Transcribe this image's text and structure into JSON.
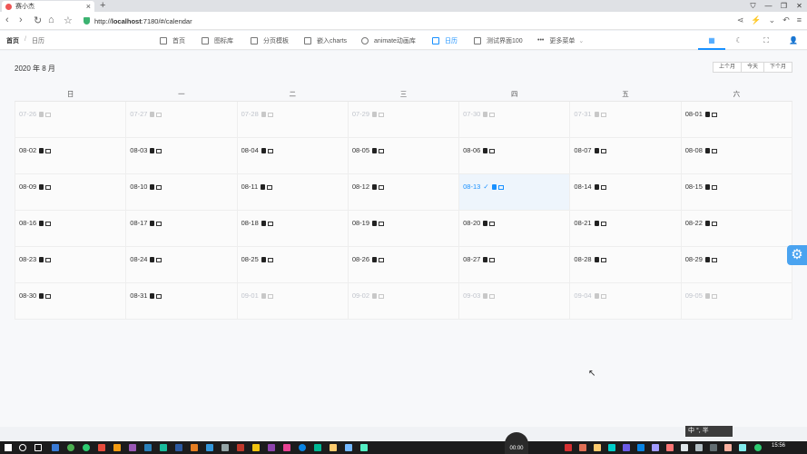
{
  "browser": {
    "tab_title": "赛小杰",
    "url_prefix": "http://",
    "url_host": "localhost",
    "url_rest": ":7180/#/calendar"
  },
  "breadcrumb": {
    "home": "首页",
    "current": "日历"
  },
  "nav": [
    {
      "label": "首页",
      "icon": "home-icon"
    },
    {
      "label": "图标库",
      "icon": "star-icon"
    },
    {
      "label": "分页模板",
      "icon": "table-icon"
    },
    {
      "label": "嵌入charts",
      "icon": "chart-icon"
    },
    {
      "label": "animate动画库",
      "icon": "search-icon"
    },
    {
      "label": "日历",
      "icon": "calendar-icon",
      "active": true
    },
    {
      "label": "测试界面100",
      "icon": "document-icon"
    },
    {
      "label": "更多菜单",
      "icon": "more-icon"
    }
  ],
  "calendar": {
    "title": "2020 年 8 月",
    "prev_label": "上个月",
    "today_label": "今天",
    "next_label": "下个月",
    "weekdays": [
      "日",
      "一",
      "二",
      "三",
      "四",
      "五",
      "六"
    ],
    "weeks": [
      [
        "07-26",
        "07-27",
        "07-28",
        "07-29",
        "07-30",
        "07-31",
        "08-01"
      ],
      [
        "08-02",
        "08-03",
        "08-04",
        "08-05",
        "08-06",
        "08-07",
        "08-08"
      ],
      [
        "08-09",
        "08-10",
        "08-11",
        "08-12",
        "08-13",
        "08-14",
        "08-15"
      ],
      [
        "08-16",
        "08-17",
        "08-18",
        "08-19",
        "08-20",
        "08-21",
        "08-22"
      ],
      [
        "08-23",
        "08-24",
        "08-25",
        "08-26",
        "08-27",
        "08-28",
        "08-29"
      ],
      [
        "08-30",
        "08-31",
        "09-01",
        "09-02",
        "09-03",
        "09-04",
        "09-05"
      ]
    ],
    "current_month_prefix": "08",
    "today_date": "08-13"
  },
  "ime": {
    "label": "中 °, 半 "
  },
  "taskbar": {
    "time": "15:56",
    "recorder": "00:00"
  }
}
